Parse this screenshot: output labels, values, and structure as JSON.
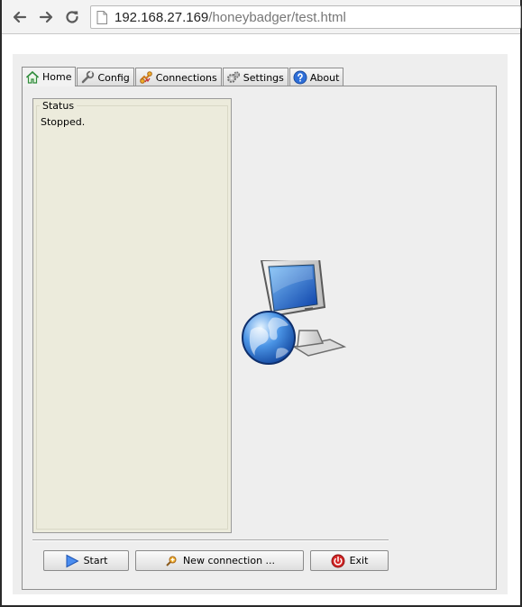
{
  "browser": {
    "url_host": "192.168.27.169",
    "url_path": "/honeybadger/test.html",
    "back_icon": "back-arrow-icon",
    "forward_icon": "forward-arrow-icon",
    "reload_icon": "reload-icon"
  },
  "tabs": [
    {
      "label": "Home",
      "icon": "home-icon",
      "active": true
    },
    {
      "label": "Config",
      "icon": "wrench-icon",
      "active": false
    },
    {
      "label": "Connections",
      "icon": "connections-icon",
      "active": false
    },
    {
      "label": "Settings",
      "icon": "gears-icon",
      "active": false
    },
    {
      "label": "About",
      "icon": "help-icon",
      "active": false
    }
  ],
  "status": {
    "legend": "Status",
    "text": "Stopped."
  },
  "buttons": {
    "start": "Start",
    "new_connection": "New connection ...",
    "exit": "Exit"
  }
}
